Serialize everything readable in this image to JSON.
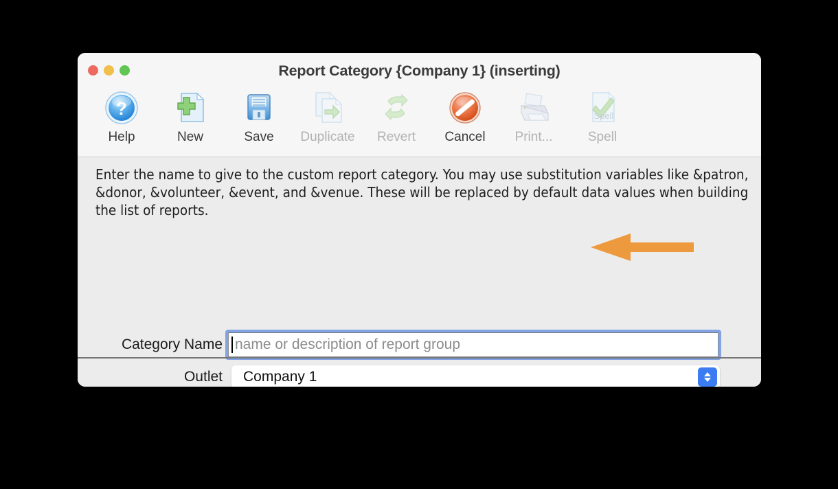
{
  "window": {
    "title": "Report Category {Company 1} (inserting)",
    "traffic_lights": [
      {
        "name": "close",
        "color": "#ec6a5f"
      },
      {
        "name": "minimize",
        "color": "#f0bf4c"
      },
      {
        "name": "zoom",
        "color": "#61c554"
      }
    ]
  },
  "toolbar": {
    "items": [
      {
        "label": "Help",
        "icon": "help-icon",
        "enabled": true
      },
      {
        "label": "New",
        "icon": "new-icon",
        "enabled": true
      },
      {
        "label": "Save",
        "icon": "save-icon",
        "enabled": true
      },
      {
        "label": "Duplicate",
        "icon": "duplicate-icon",
        "enabled": false
      },
      {
        "label": "Revert",
        "icon": "revert-icon",
        "enabled": false
      },
      {
        "label": "Cancel",
        "icon": "cancel-icon",
        "enabled": true
      },
      {
        "label": "Print...",
        "icon": "print-icon",
        "enabled": false
      },
      {
        "label": "Spell",
        "icon": "spell-icon",
        "enabled": false
      }
    ]
  },
  "content": {
    "instructions": "Enter the name to give to the custom report category.  You may use substitution variables like &patron, &donor, &volunteer, &event, and &venue.   These will be replaced by default data values when building the list of reports.",
    "category_name": {
      "label": "Category Name",
      "value": "",
      "placeholder": "name or description of report group",
      "focused": true
    },
    "outlet": {
      "label": "Outlet",
      "selected": "Company 1",
      "stepper_icon": "up-down-chevron-icon"
    }
  },
  "annotation": {
    "arrow": {
      "name": "orange-pointer-arrow",
      "direction": "left",
      "color": "#ed9a3e",
      "points_to": "category-name-input"
    }
  },
  "colors": {
    "titlebar_bg": "#f6f6f6",
    "content_bg": "#ececec",
    "focus_ring": "#83a4e4",
    "stepper_blue": "#3b7cf2",
    "arrow_orange": "#ed9a3e",
    "desktop_bg": "#000000"
  }
}
